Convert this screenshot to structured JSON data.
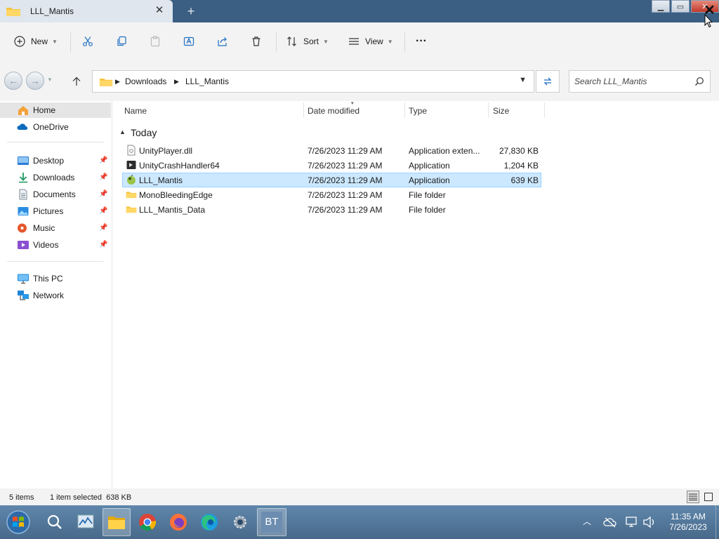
{
  "window": {
    "tab_title": "LLL_Mantis",
    "tab_close": "✕",
    "new_tab": "+"
  },
  "toolbar": {
    "new_label": "New",
    "sort_label": "Sort",
    "view_label": "View",
    "more_label": "···"
  },
  "address": {
    "crumbs": [
      "Downloads",
      "LLL_Mantis"
    ]
  },
  "search": {
    "placeholder": "Search LLL_Mantis"
  },
  "sidebar": {
    "items": [
      {
        "label": "Home",
        "icon": "home-icon",
        "pinned": false
      },
      {
        "label": "OneDrive",
        "icon": "onedrive-icon",
        "pinned": false
      },
      {
        "label": "Desktop",
        "icon": "desktop-icon",
        "pinned": true
      },
      {
        "label": "Downloads",
        "icon": "downloads-icon",
        "pinned": true
      },
      {
        "label": "Documents",
        "icon": "documents-icon",
        "pinned": true
      },
      {
        "label": "Pictures",
        "icon": "pictures-icon",
        "pinned": true
      },
      {
        "label": "Music",
        "icon": "music-icon",
        "pinned": true
      },
      {
        "label": "Videos",
        "icon": "videos-icon",
        "pinned": true
      },
      {
        "label": "This PC",
        "icon": "this-pc-icon",
        "pinned": false
      },
      {
        "label": "Network",
        "icon": "network-icon",
        "pinned": false
      }
    ]
  },
  "columns": {
    "name": "Name",
    "date": "Date modified",
    "type": "Type",
    "size": "Size"
  },
  "group": {
    "label": "Today"
  },
  "files": [
    {
      "name": "UnityPlayer.dll",
      "date": "7/26/2023 11:29 AM",
      "type": "Application exten...",
      "size": "27,830 KB",
      "icon": "dll-file-icon",
      "selected": false
    },
    {
      "name": "UnityCrashHandler64",
      "date": "7/26/2023 11:29 AM",
      "type": "Application",
      "size": "1,204 KB",
      "icon": "unity-app-icon",
      "selected": false
    },
    {
      "name": "LLL_Mantis",
      "date": "7/26/2023 11:29 AM",
      "type": "Application",
      "size": "639 KB",
      "icon": "mantis-app-icon",
      "selected": true
    },
    {
      "name": "MonoBleedingEdge",
      "date": "7/26/2023 11:29 AM",
      "type": "File folder",
      "size": "",
      "icon": "folder-icon",
      "selected": false
    },
    {
      "name": "LLL_Mantis_Data",
      "date": "7/26/2023 11:29 AM",
      "type": "File folder",
      "size": "",
      "icon": "folder-icon",
      "selected": false
    }
  ],
  "status": {
    "count": "5 items",
    "selection": "1 item selected  638 KB"
  },
  "taskbar": {
    "apps": [
      "start-orb",
      "search",
      "task-manager",
      "file-explorer",
      "chrome",
      "firefox",
      "edge",
      "settings",
      "bt-app"
    ],
    "bt_label": "BT"
  },
  "clock": {
    "time": "11:35 AM",
    "date": "7/26/2023"
  },
  "colors": {
    "accent": "#0078d4",
    "selection_bg": "#cce8ff",
    "selection_border": "#99d1ff",
    "folder": "#f5c444",
    "titlebar": "#3b5f82"
  }
}
